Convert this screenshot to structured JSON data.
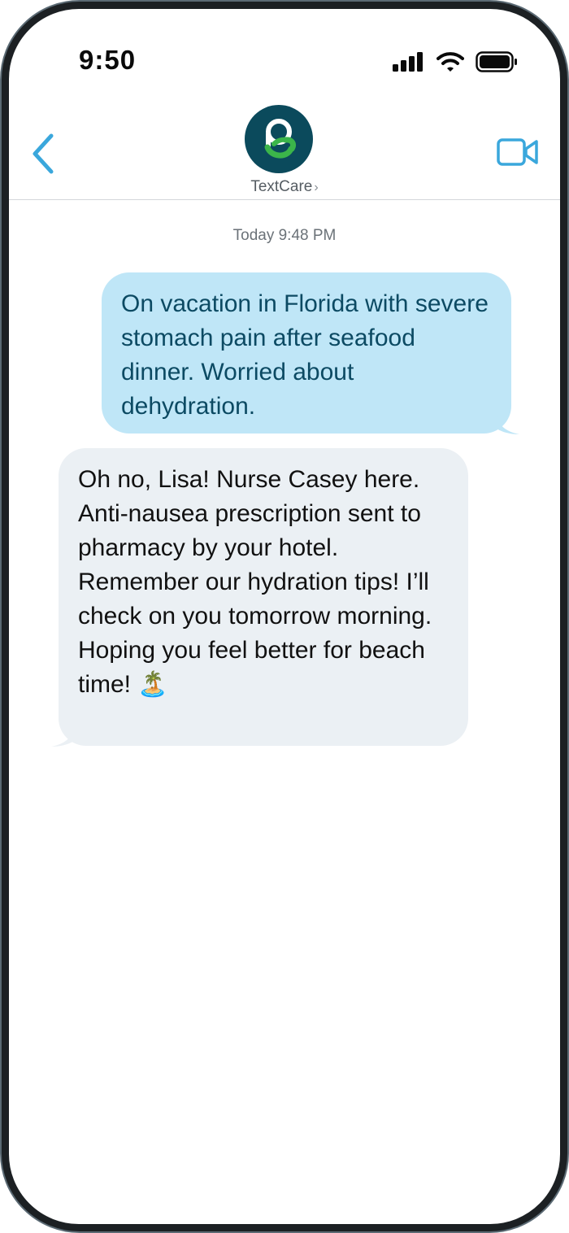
{
  "status_bar": {
    "time": "9:50",
    "icons": [
      "signal-bars-icon",
      "wifi-icon",
      "battery-icon"
    ]
  },
  "header": {
    "back_icon": "chevron-left-icon",
    "contact_name": "TextCare",
    "contact_chevron": "›",
    "video_icon": "video-camera-icon",
    "avatar_icon": "textcare-logo"
  },
  "conversation": {
    "timestamp": "Today 9:48 PM",
    "messages": [
      {
        "direction": "outgoing",
        "text": "On vacation in Florida with severe stomach pain after seafood dinner. Worried about dehydration."
      },
      {
        "direction": "incoming",
        "text": "Oh no, Lisa! Nurse Casey here. Anti-nausea prescription sent to pharmacy by your hotel. Remember our hydration tips! I’ll check on you tomorrow morning. Hoping you feel better for beach time! 🏝️"
      }
    ]
  },
  "colors": {
    "accent": "#3aa7dc",
    "outgoing_bubble": "#bfe6f7",
    "outgoing_text": "#0c4a63",
    "incoming_bubble": "#ebf0f4",
    "avatar_bg": "#0b4a5c",
    "logo_green": "#3bb54a"
  }
}
